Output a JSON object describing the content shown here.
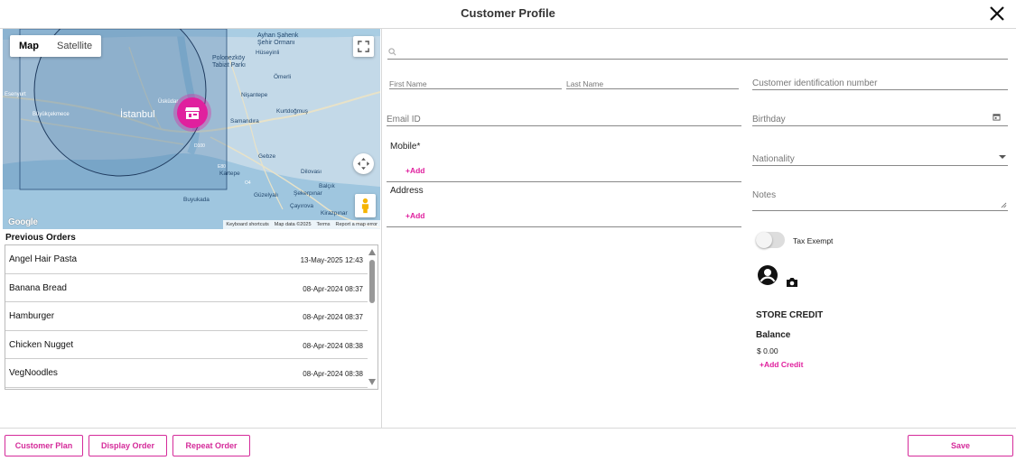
{
  "header": {
    "title": "Customer Profile",
    "close_icon": "close-icon"
  },
  "map": {
    "type_control": {
      "map": "Map",
      "satellite": "Satellite",
      "active": "Map"
    },
    "labels": {
      "istanbul": "İstanbul",
      "ayhan": "Ayhan Şahenk",
      "sehir": "Şehir Ormanı",
      "polonezkoy": "Polonezköy",
      "tabiat": "Tabiat Parkı",
      "huseyinli": "Hüseyinli",
      "omerli": "Ömerli",
      "nisantepe": "Nişantepe",
      "kurtdogmus": "Kurtdoğmuş",
      "samandira": "Samandıra",
      "esenyurt": "Esenyurt",
      "buyukcekmece": "Büyükçekmece",
      "uskudar": "Üsküdar",
      "gulizar": "Güzelyalı",
      "gebze": "Gebze",
      "sekerpinar": "Şekerpınar",
      "balcik": "Balçık",
      "kartepe": "Kartepe",
      "buyukada": "Buyukada",
      "cayirova": "Çayırova",
      "kirazpinar": "Kirazpınar",
      "dilovasi": "Dilovası",
      "d100": "D100",
      "e80": "E80",
      "o4": "O4"
    },
    "google": "Google",
    "footer": [
      "Keyboard shortcuts",
      "Map data ©2025",
      "Terms",
      "Report a map error"
    ],
    "colors": {
      "water": "#9ec7e0",
      "land": "#c6dbe9",
      "circle": "#1e4b7a",
      "marker": "#e0209e"
    }
  },
  "previous_orders": {
    "title": "Previous Orders",
    "rows": [
      {
        "name": "Angel Hair Pasta",
        "date": "13-May-2025 12:43"
      },
      {
        "name": "Banana Bread",
        "date": "08-Apr-2024 08:37"
      },
      {
        "name": "Hamburger",
        "date": "08-Apr-2024 08:37"
      },
      {
        "name": "Chicken Nugget",
        "date": "08-Apr-2024 08:38"
      },
      {
        "name": "VegNoodles",
        "date": "08-Apr-2024 08:38"
      }
    ]
  },
  "form": {
    "search_placeholder": "",
    "first_name_placeholder": "First Name",
    "last_name_placeholder": "Last Name",
    "customer_id_placeholder": "Customer identification number",
    "email_placeholder": "Email ID",
    "birthday_placeholder": "Birthday",
    "mobile_label": "Mobile*",
    "mobile_add": "+Add",
    "nationality_placeholder": "Nationality",
    "address_label": "Address",
    "address_add": "+Add",
    "notes_placeholder": "Notes",
    "tax_exempt_label": "Tax Exempt",
    "tax_exempt_on": false
  },
  "store_credit": {
    "title": "STORE CREDIT",
    "balance_label": "Balance",
    "balance_value": "$ 0.00",
    "add_credit": "+Add Credit"
  },
  "footer": {
    "customer_plan": "Customer Plan",
    "display_order": "Display Order",
    "repeat_order": "Repeat Order",
    "save": "Save"
  },
  "colors": {
    "accent": "#d52b9a"
  }
}
